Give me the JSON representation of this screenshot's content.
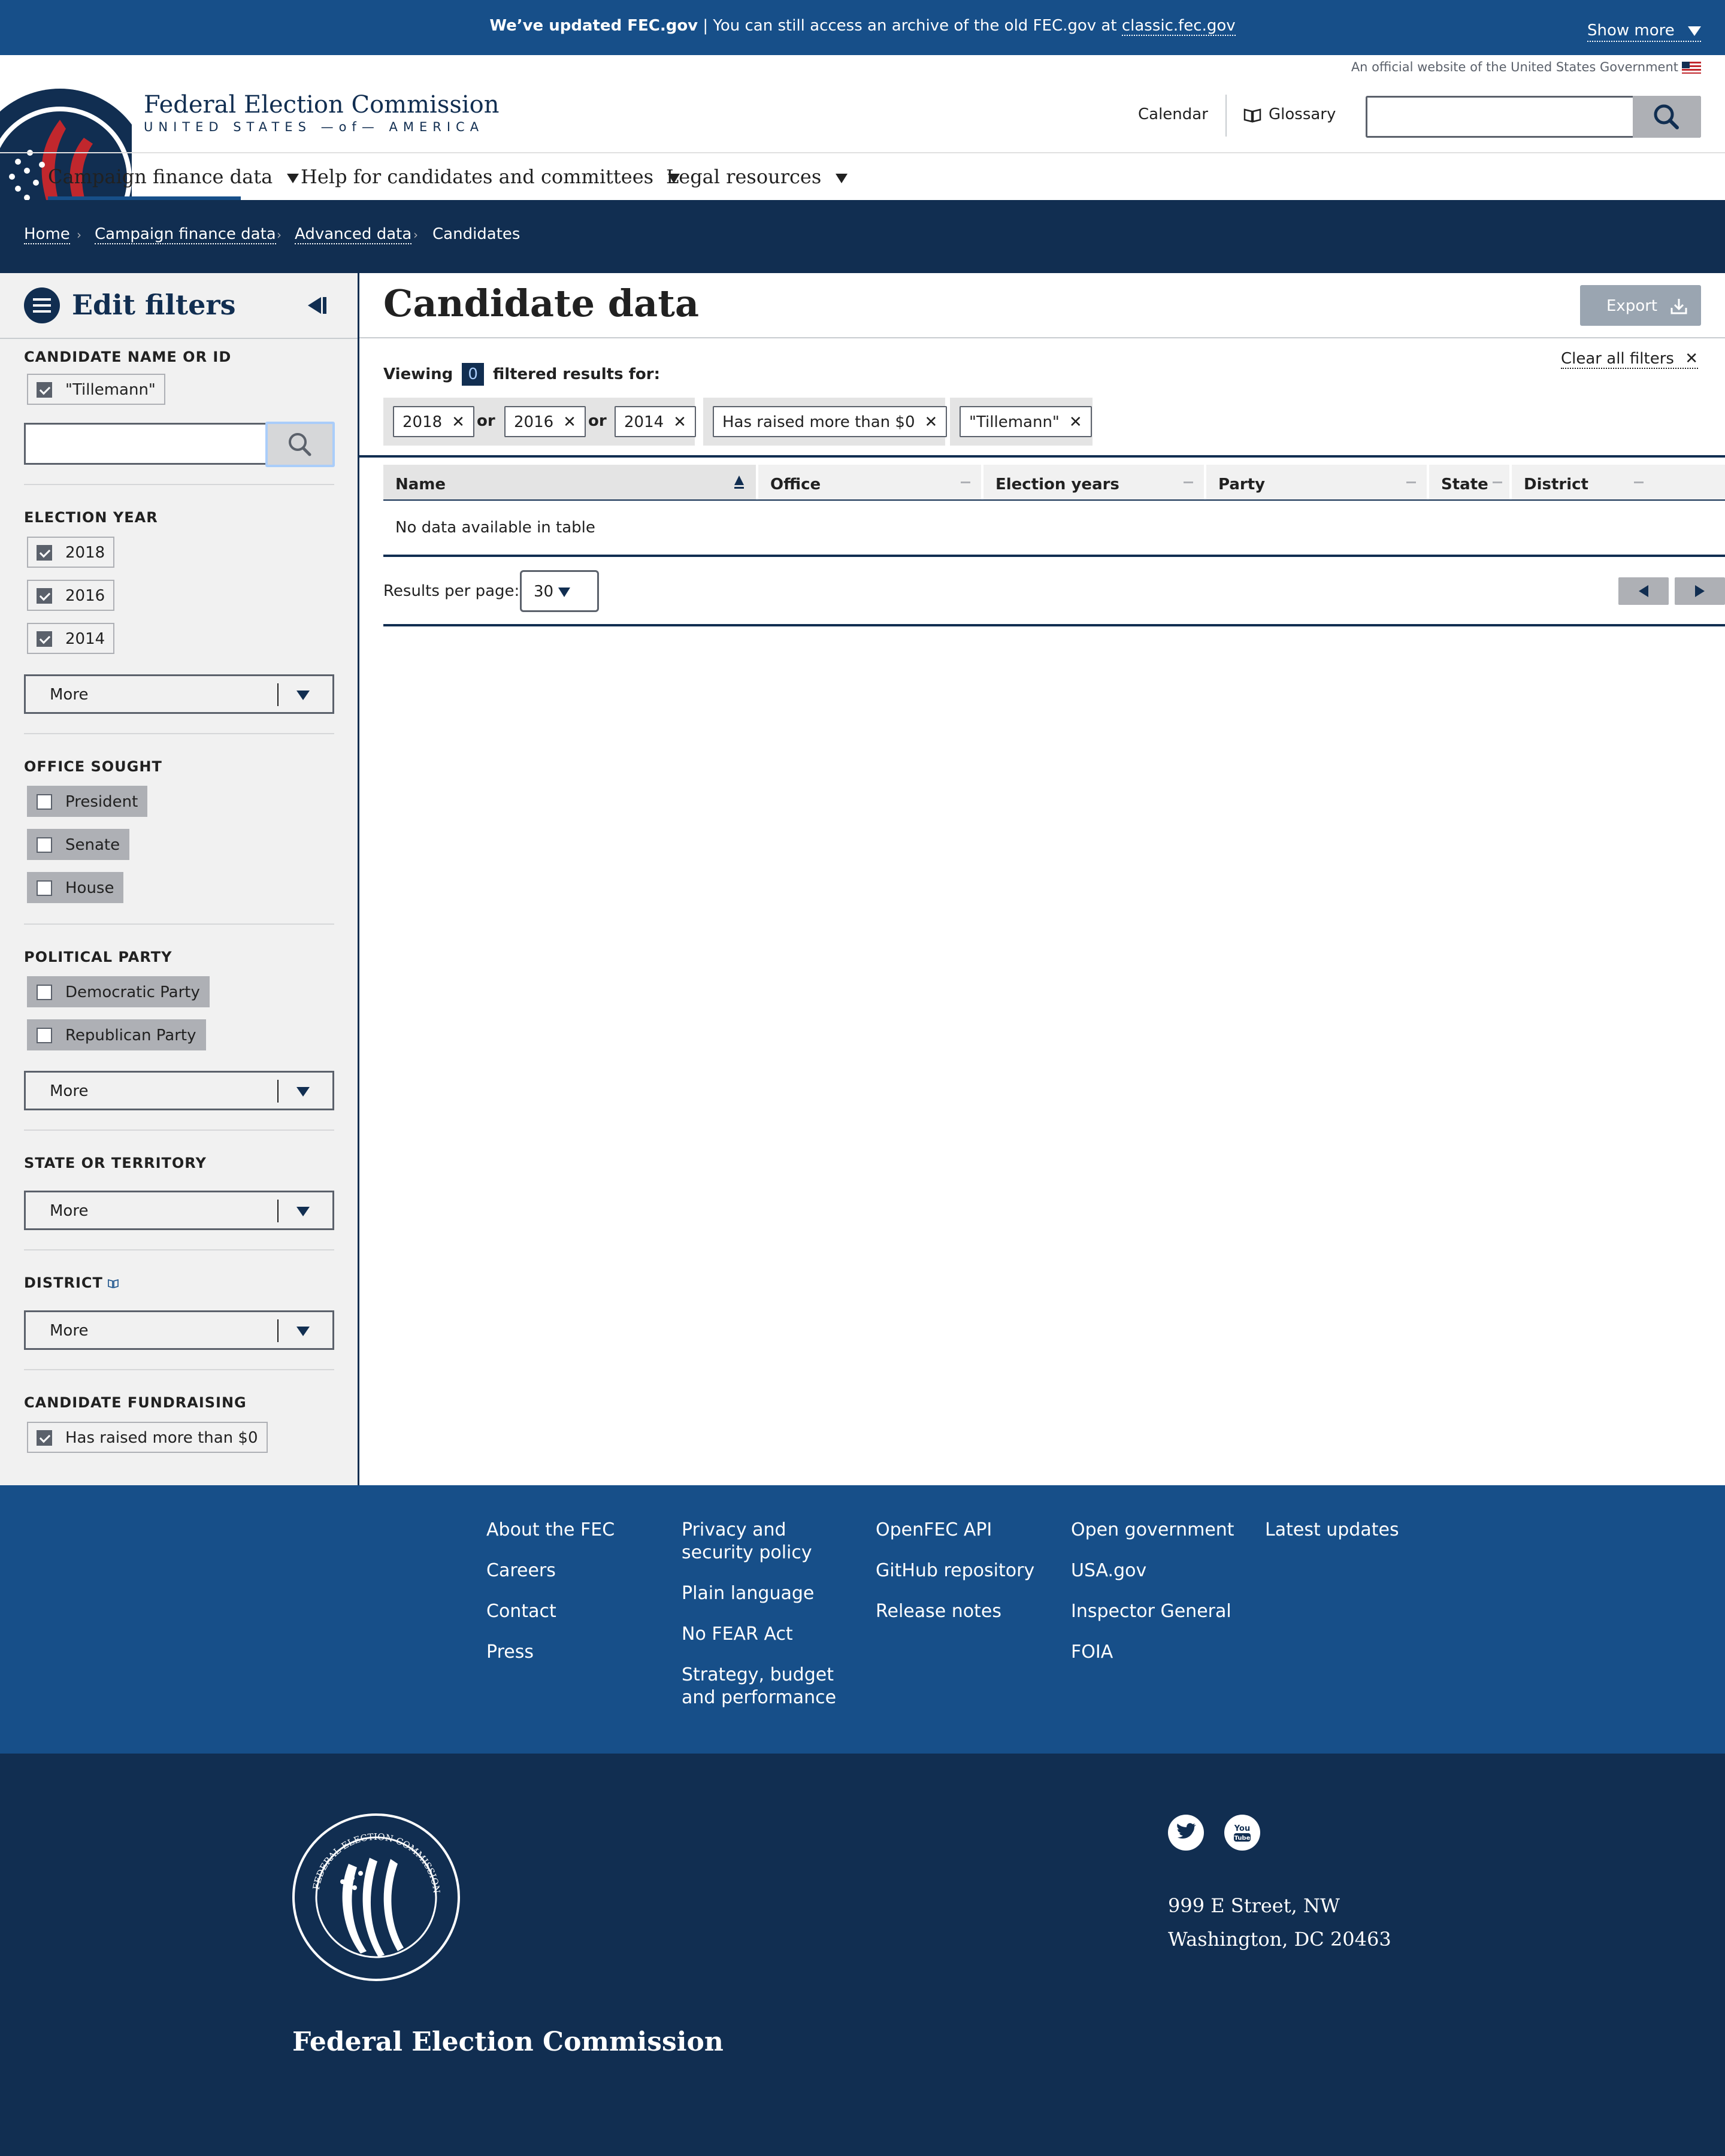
{
  "banner": {
    "lead": "We’ve updated FEC.gov",
    "rest": " | You can still access an archive of the old FEC.gov at ",
    "link": "classic.fec.gov",
    "show_more": "Show more"
  },
  "official": "An official website of the United States Government",
  "brand": {
    "name": "Federal Election Commission",
    "sub": "UNITED STATES —of— AMERICA",
    "seal_text": "ELECTION COMMISSION"
  },
  "header_links": {
    "calendar": "Calendar",
    "glossary": "Glossary"
  },
  "nav": [
    "Campaign finance data",
    "Help for candidates and committees",
    "Legal resources"
  ],
  "breadcrumb": {
    "home": "Home",
    "l1": "Campaign finance data",
    "l2": "Advanced data",
    "current": "Candidates"
  },
  "sidebar": {
    "title": "Edit filters",
    "name_section": "CANDIDATE NAME OR ID",
    "name_tag": "\"Tillemann\"",
    "year_section": "ELECTION YEAR",
    "years": [
      "2018",
      "2016",
      "2014"
    ],
    "more": "More",
    "office_section": "OFFICE SOUGHT",
    "offices": [
      "President",
      "Senate",
      "House"
    ],
    "party_section": "POLITICAL PARTY",
    "parties": [
      "Democratic Party",
      "Republican Party"
    ],
    "state_section": "STATE OR TERRITORY",
    "district_section": "DISTRICT",
    "fund_section": "CANDIDATE FUNDRAISING",
    "fund_option": "Has raised more than $0"
  },
  "main": {
    "title": "Candidate data",
    "export": "Export",
    "viewing": "Viewing",
    "count": "0",
    "filtered": "filtered results for:",
    "clear": "Clear all filters",
    "tags": {
      "y1": "2018",
      "y2": "2016",
      "y3": "2014",
      "or": "or",
      "raised": "Has raised more than $0",
      "name": "\"Tillemann\""
    },
    "columns": [
      "Name",
      "Office",
      "Election years",
      "Party",
      "State",
      "District"
    ],
    "nodata": "No data available in table",
    "rpp_label": "Results per page:",
    "rpp_value": "30"
  },
  "footer": {
    "col1": [
      "About the FEC",
      "Careers",
      "Contact",
      "Press"
    ],
    "col2": [
      "Privacy and security policy",
      "Plain language",
      "No FEAR Act",
      "Strategy, budget and performance"
    ],
    "col3": [
      "OpenFEC API",
      "GitHub repository",
      "Release notes"
    ],
    "col4": [
      "Open government",
      "USA.gov",
      "Inspector General",
      "FOIA"
    ],
    "col5": [
      "Latest updates"
    ],
    "name": "Federal Election Commission",
    "address1": "999 E Street, NW",
    "address2": "Washington, DC 20463",
    "seal_text": "FEDERAL ELECTION COMMISSION · UNITED STATES OF AMERICA",
    "youtube_text": "You Tube"
  }
}
